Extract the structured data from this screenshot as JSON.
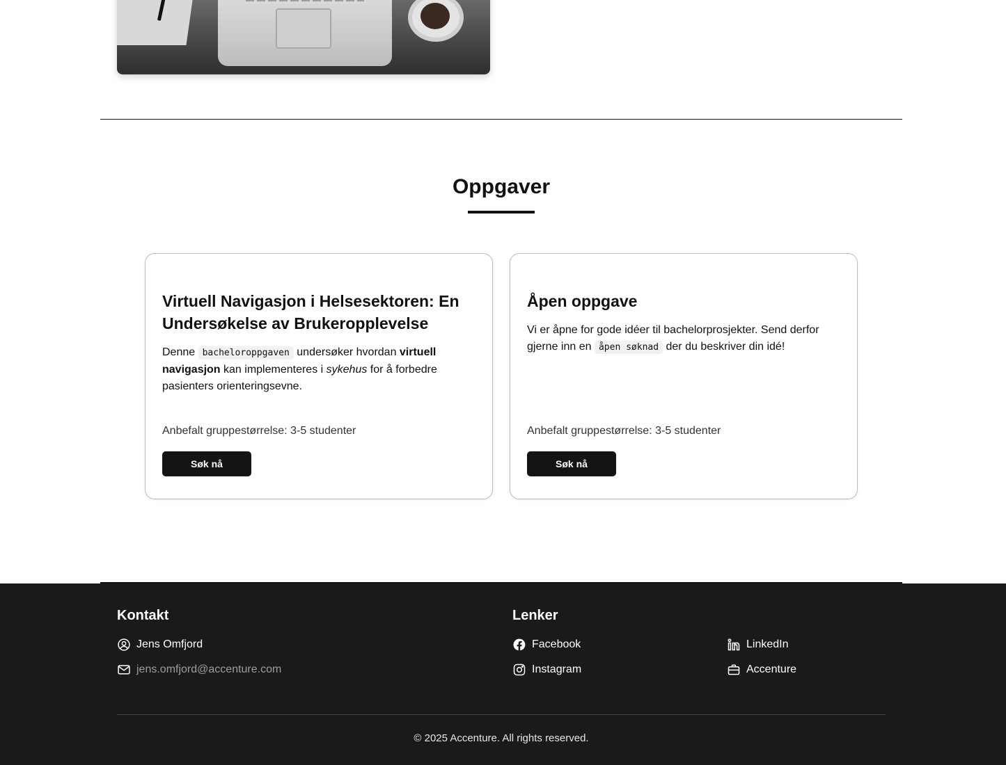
{
  "section": {
    "title": "Oppgaver"
  },
  "cards": [
    {
      "title": "Virtuell Navigasjon i Helsesektoren: En Undersøkelse av Brukeropplevelse",
      "desc_parts": {
        "p1": "Denne ",
        "code": "bacheloroppgaven",
        "p2": " undersøker hvordan ",
        "bold": "virtuell navigasjon",
        "p3": " kan implementeres i ",
        "italic": "sykehus",
        "p4": " for å forbedre pasienters orienteringsevne."
      },
      "group_size": "Anbefalt gruppestørrelse: 3-5 studenter",
      "button": "Søk nå"
    },
    {
      "title": "Åpen oppgave",
      "desc_parts": {
        "p1": "Vi er åpne for gode idéer til bachelorprosjekter. Send derfor gjerne inn en ",
        "code": "åpen søknad",
        "p2": " der du beskriver din idé!"
      },
      "group_size": "Anbefalt gruppestørrelse: 3-5 studenter",
      "button": "Søk nå"
    }
  ],
  "footer": {
    "contact_heading": "Kontakt",
    "contact_name": "Jens Omfjord",
    "contact_email": "jens.omfjord@accenture.com",
    "links_heading": "Lenker",
    "links": [
      "Facebook",
      "Instagram",
      "LinkedIn",
      "Accenture"
    ],
    "copyright": "© 2025 Accenture. All rights reserved."
  }
}
